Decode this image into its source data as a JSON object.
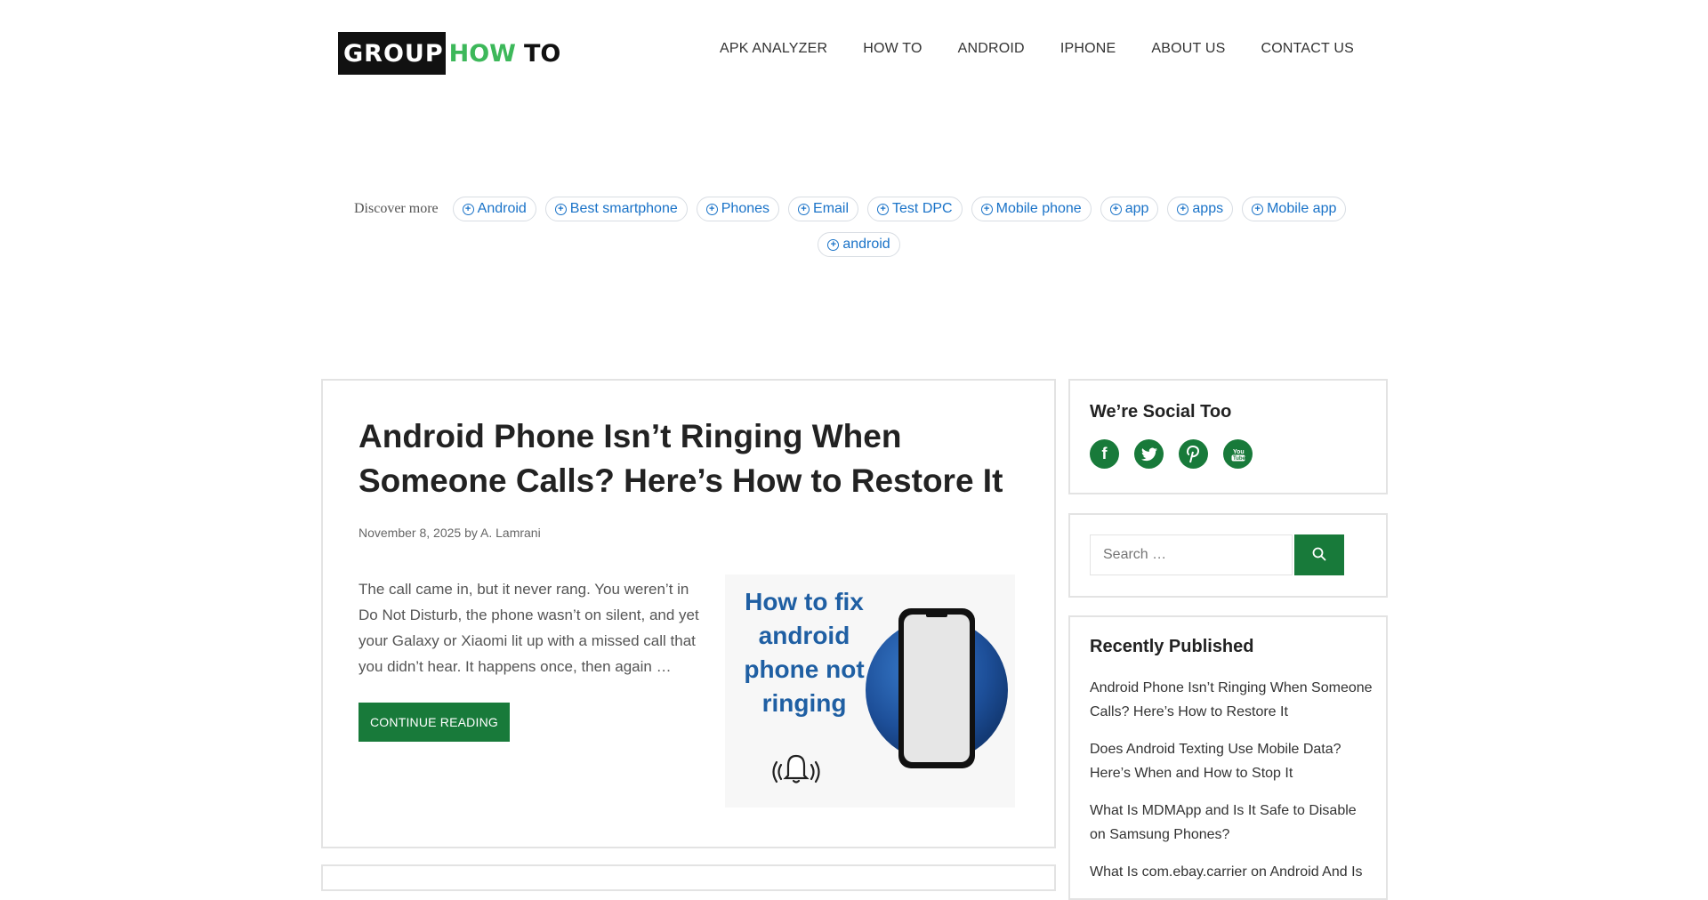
{
  "header": {
    "logo": {
      "group": "GROUP",
      "how": "HOW",
      "to": "TO"
    },
    "nav": [
      "APK ANALYZER",
      "HOW TO",
      "ANDROID",
      "IPHONE",
      "ABOUT US",
      "CONTACT US"
    ]
  },
  "discover": {
    "label": "Discover more",
    "tags": [
      "Android",
      "Best smartphone",
      "Phones",
      "Email",
      "Test DPC",
      "Mobile phone",
      "app",
      "apps",
      "Mobile app"
    ],
    "tags_row2": [
      "android"
    ]
  },
  "post": {
    "title": "Android Phone Isn’t Ringing When Someone Calls? Here’s How to Restore It",
    "date": "November 8, 2025",
    "by": "by",
    "author": "A. Lamrani",
    "excerpt": "The call came in, but it never rang. You weren’t in Do Not Disturb, the phone wasn’t on silent, and yet your Galaxy or Xiaomi lit up with a missed call that you didn’t hear. It happens once, then again …",
    "cta": "CONTINUE READING",
    "thumbnail_text": "How to fix android phone not ringing"
  },
  "sidebar": {
    "social_title": "We’re Social Too",
    "social_icons": [
      "facebook-icon",
      "twitter-icon",
      "pinterest-icon",
      "youtube-icon"
    ],
    "search_placeholder": "Search …",
    "recent_title": "Recently Published",
    "recent": [
      "Android Phone Isn’t Ringing When Someone Calls? Here’s How to Restore It",
      "Does Android Texting Use Mobile Data? Here’s When and How to Stop It",
      "What Is MDMApp and Is It Safe to Disable on Samsung Phones?",
      "What Is com.ebay.carrier on Android And Is"
    ]
  },
  "colors": {
    "accent": "#187a3a",
    "link": "#1a73c8",
    "logo_green": "#3db85a"
  }
}
